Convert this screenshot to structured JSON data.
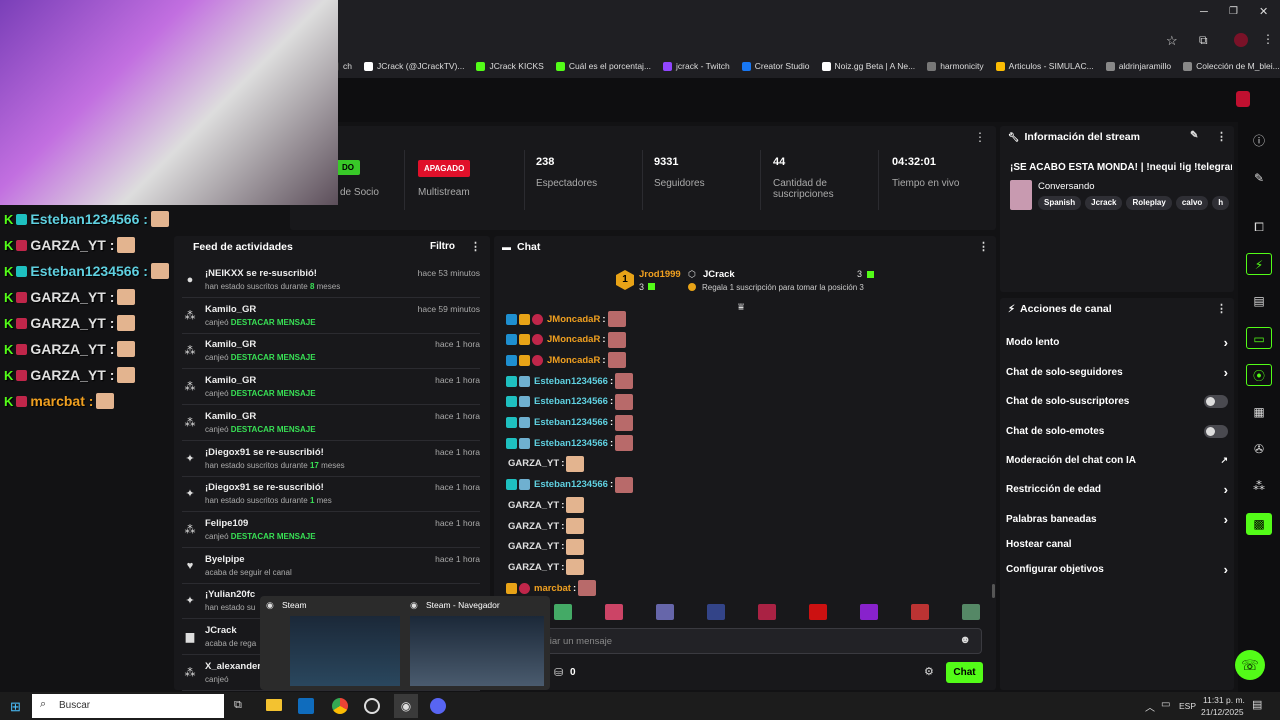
{
  "browser": {
    "bookmarks": [
      {
        "label": "ch",
        "color": "#333"
      },
      {
        "label": "JCrack (@JCrackTV)...",
        "color": "#fff"
      },
      {
        "label": "JCrack KICKS",
        "color": "#53fc18"
      },
      {
        "label": "Cuál es el porcentaj...",
        "color": "#53fc18"
      },
      {
        "label": "jcrack - Twitch",
        "color": "#9146ff"
      },
      {
        "label": "Creator Studio",
        "color": "#1877f2"
      },
      {
        "label": "Noiz.gg Beta | A Ne...",
        "color": "#fff"
      },
      {
        "label": "harmonicity",
        "color": "#777"
      },
      {
        "label": "Articulos - SIMULAC...",
        "color": "#fbbc04"
      },
      {
        "label": "aldrinjaramillo",
        "color": "#888"
      },
      {
        "label": "Colección de M_blei...",
        "color": "#888"
      }
    ]
  },
  "stats": {
    "socio_badge": "DO",
    "socio_label": "de Socio",
    "multistream_badge": "APAGADO",
    "multistream_label": "Multistream",
    "viewers_value": "238",
    "viewers_label": "Espectadores",
    "followers_value": "9331",
    "followers_label": "Seguidores",
    "subs_value": "44",
    "subs_label": "Cantidad de suscripciones",
    "time_value": "04:32:01",
    "time_label": "Tiempo en vivo"
  },
  "feed": {
    "title": "Feed de actividades",
    "filter": "Filtro",
    "items": [
      {
        "title": "¡NEIKXX se re-suscribió!",
        "sub_pre": "han estado suscritos durante ",
        "sub_em": "8",
        "sub_post": " meses",
        "time": "hace 53 minutos",
        "icon": "●"
      },
      {
        "title": "Kamilo_GR",
        "sub_pre": "canjeó ",
        "sub_em": "DESTACAR MENSAJE",
        "sub_post": "",
        "time": "hace 59 minutos",
        "icon": "⁂"
      },
      {
        "title": "Kamilo_GR",
        "sub_pre": "canjeó ",
        "sub_em": "DESTACAR MENSAJE",
        "sub_post": "",
        "time": "hace 1 hora",
        "icon": "⁂"
      },
      {
        "title": "Kamilo_GR",
        "sub_pre": "canjeó ",
        "sub_em": "DESTACAR MENSAJE",
        "sub_post": "",
        "time": "hace 1 hora",
        "icon": "⁂"
      },
      {
        "title": "Kamilo_GR",
        "sub_pre": "canjeó ",
        "sub_em": "DESTACAR MENSAJE",
        "sub_post": "",
        "time": "hace 1 hora",
        "icon": "⁂"
      },
      {
        "title": "¡Diegox91 se re-suscribió!",
        "sub_pre": "han estado suscritos durante ",
        "sub_em": "17",
        "sub_post": " meses",
        "time": "hace 1 hora",
        "icon": "✦"
      },
      {
        "title": "¡Diegox91 se re-suscribió!",
        "sub_pre": "han estado suscritos durante ",
        "sub_em": "1",
        "sub_post": " mes",
        "time": "hace 1 hora",
        "icon": "✦"
      },
      {
        "title": "Felipe109",
        "sub_pre": "canjeó ",
        "sub_em": "DESTACAR MENSAJE",
        "sub_post": "",
        "time": "hace 1 hora",
        "icon": "⁂"
      },
      {
        "title": "Byelpipe",
        "sub_pre": "acaba de seguir el canal",
        "sub_em": "",
        "sub_post": "",
        "time": "hace 1 hora",
        "icon": "♥"
      },
      {
        "title": "¡Yulian20fc",
        "sub_pre": "han estado su",
        "sub_em": "",
        "sub_post": "",
        "time": "",
        "icon": "✦"
      },
      {
        "title": "JCrack",
        "sub_pre": "acaba de rega",
        "sub_em": "",
        "sub_post": "",
        "time": "",
        "icon": "▆"
      },
      {
        "title": "X_alexander",
        "sub_pre": "canjeó",
        "sub_em": "",
        "sub_post": "",
        "time": "",
        "icon": "⁂"
      }
    ]
  },
  "chat": {
    "title": "Chat",
    "leader_name": "Jrod1999",
    "leader_count": "3",
    "broadcaster": "JCrack",
    "broadcaster_count": "3",
    "gift_text": "Regala 1 suscripción para tomar la posición 3",
    "leader_rank": "1",
    "messages": [
      {
        "user": "JMoncadaR",
        "color": "#f0a020",
        "type": "mod"
      },
      {
        "user": "JMoncadaR",
        "color": "#f0a020",
        "type": "mod"
      },
      {
        "user": "JMoncadaR",
        "color": "#f0a020",
        "type": "mod"
      },
      {
        "user": "Esteban1234566",
        "color": "#5fd0e0",
        "type": "sub"
      },
      {
        "user": "Esteban1234566",
        "color": "#5fd0e0",
        "type": "sub"
      },
      {
        "user": "Esteban1234566",
        "color": "#5fd0e0",
        "type": "sub"
      },
      {
        "user": "Esteban1234566",
        "color": "#5fd0e0",
        "type": "sub"
      },
      {
        "user": "GARZA_YT",
        "color": "#e0e0e0",
        "type": "plain"
      },
      {
        "user": "Esteban1234566",
        "color": "#5fd0e0",
        "type": "sub"
      },
      {
        "user": "GARZA_YT",
        "color": "#e0e0e0",
        "type": "plain"
      },
      {
        "user": "GARZA_YT",
        "color": "#e0e0e0",
        "type": "plain"
      },
      {
        "user": "GARZA_YT",
        "color": "#e0e0e0",
        "type": "plain"
      },
      {
        "user": "GARZA_YT",
        "color": "#e0e0e0",
        "type": "plain"
      },
      {
        "user": "marcbat",
        "color": "#f0a020",
        "type": "crown"
      }
    ],
    "placeholder": "viar un mensaje",
    "points": "0",
    "send_label": "Chat"
  },
  "info": {
    "title": "Información del stream",
    "stream_title": "¡SE ACABÓ ESTA MONDÁ! | !nequi !ig !telegram",
    "category": "Conversando",
    "tags": [
      "Spanish",
      "Jcrack",
      "Roleplay",
      "calvo",
      "h"
    ]
  },
  "actions": {
    "title": "Acciones de canal",
    "items": [
      {
        "label": "Modo lento",
        "ctrl": "chevron"
      },
      {
        "label": "Chat de solo-seguidores",
        "ctrl": "chevron"
      },
      {
        "label": "Chat de solo-suscriptores",
        "ctrl": "toggle"
      },
      {
        "label": "Chat de solo-emotes",
        "ctrl": "toggle"
      },
      {
        "label": "Moderación del chat con IA",
        "ctrl": "external"
      },
      {
        "label": "Restricción de edad",
        "ctrl": "chevron"
      },
      {
        "label": "Palabras baneadas",
        "ctrl": "chevron"
      },
      {
        "label": "Hostear canal",
        "ctrl": "none"
      },
      {
        "label": "Configurar objetivos",
        "ctrl": "chevron"
      }
    ]
  },
  "overlay": {
    "lines": [
      {
        "user": "Esteban1234566 :",
        "color": "#5fd0e0"
      },
      {
        "user": "GARZA_YT :",
        "color": "#e0e0e0"
      },
      {
        "user": "Esteban1234566 :",
        "color": "#5fd0e0"
      },
      {
        "user": "GARZA_YT :",
        "color": "#e0e0e0"
      },
      {
        "user": "GARZA_YT :",
        "color": "#e0e0e0"
      },
      {
        "user": "GARZA_YT :",
        "color": "#e0e0e0"
      },
      {
        "user": "GARZA_YT :",
        "color": "#e0e0e0"
      },
      {
        "user": "marcbat :",
        "color": "#f0a020"
      }
    ]
  },
  "taskbar": {
    "search": "Buscar",
    "lang": "ESP",
    "time": "11:31 p. m.",
    "date": "21/12/2025",
    "popup_a": "Steam",
    "popup_b": "Steam - Navegador"
  },
  "colors": {
    "accent": "#53fc18",
    "danger": "#e0102a"
  }
}
